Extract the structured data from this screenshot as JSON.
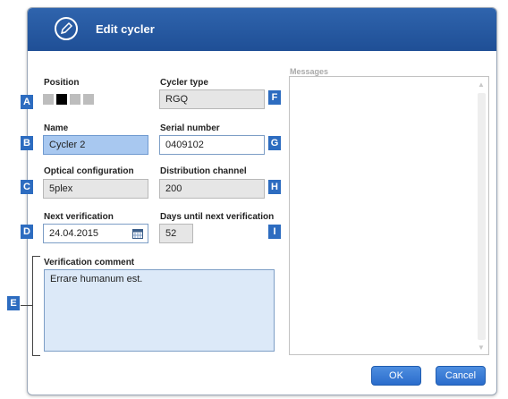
{
  "dialog": {
    "title": "Edit cycler"
  },
  "position": {
    "label": "Position",
    "slots": [
      false,
      true,
      false,
      false
    ]
  },
  "cycler_type": {
    "label": "Cycler type",
    "value": "RGQ"
  },
  "name": {
    "label": "Name",
    "value": "Cycler 2"
  },
  "serial_number": {
    "label": "Serial number",
    "value": "0409102"
  },
  "optical_configuration": {
    "label": "Optical configuration",
    "value": "5plex"
  },
  "distribution_channel": {
    "label": "Distribution channel",
    "value": "200"
  },
  "next_verification": {
    "label": "Next verification",
    "value": "24.04.2015"
  },
  "days_until_next_verification": {
    "label": "Days until next verification",
    "value": "52"
  },
  "verification_comment": {
    "label": "Verification comment",
    "value": "Errare humanum est."
  },
  "messages": {
    "label": "Messages"
  },
  "buttons": {
    "ok": "OK",
    "cancel": "Cancel"
  },
  "markers": {
    "a": "A",
    "b": "B",
    "c": "C",
    "d": "D",
    "e": "E",
    "f": "F",
    "g": "G",
    "h": "H",
    "i": "I"
  },
  "colors": {
    "titlebar": "#2360a8",
    "marker": "#2d6cc0",
    "button": "#3a7ad6",
    "field_selected": "#a8c8f0"
  }
}
